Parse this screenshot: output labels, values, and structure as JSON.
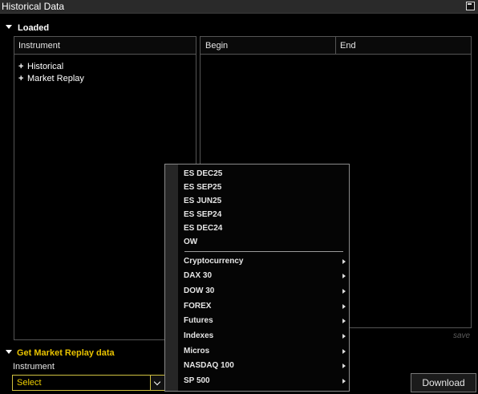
{
  "window": {
    "title": "Historical Data"
  },
  "loaded": {
    "header": "Loaded",
    "instrument_col": "Instrument",
    "tree": [
      "Historical",
      "Market Replay"
    ],
    "begin_col": "Begin",
    "end_col": "End",
    "save_label": "save"
  },
  "get_replay": {
    "header": "Get Market Replay data",
    "instrument_label": "Instrument",
    "select_value": "Select",
    "download_label": "Download"
  },
  "dropdown": {
    "recent": [
      "ES DEC25",
      "ES SEP25",
      "ES JUN25",
      "ES SEP24",
      "ES DEC24",
      "OW"
    ],
    "categories": [
      "Cryptocurrency",
      "DAX 30",
      "DOW 30",
      "FOREX",
      "Futures",
      "Indexes",
      "Micros",
      "NASDAQ 100",
      "SP 500"
    ]
  },
  "colors": {
    "accent": "#f0d000",
    "background": "#000000",
    "border": "#555555"
  }
}
